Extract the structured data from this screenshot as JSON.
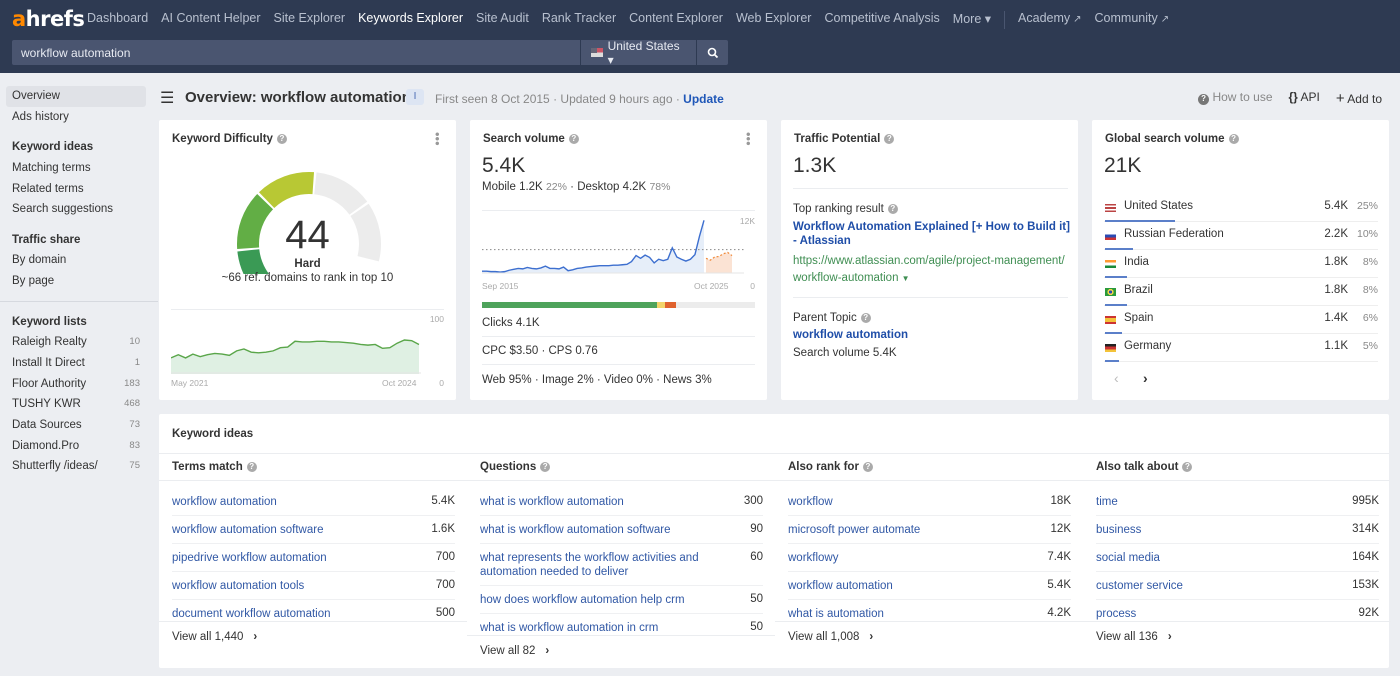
{
  "topnav": {
    "logo_accent": "a",
    "logo_rest": "hrefs",
    "items": [
      {
        "label": "Dashboard",
        "active": false
      },
      {
        "label": "AI Content Helper",
        "active": false
      },
      {
        "label": "Site Explorer",
        "active": false
      },
      {
        "label": "Keywords Explorer",
        "active": true
      },
      {
        "label": "Site Audit",
        "active": false
      },
      {
        "label": "Rank Tracker",
        "active": false
      },
      {
        "label": "Content Explorer",
        "active": false
      },
      {
        "label": "Web Explorer",
        "active": false
      },
      {
        "label": "Competitive Analysis",
        "active": false
      },
      {
        "label": "More ▾",
        "active": false
      }
    ],
    "external": [
      {
        "label": "Academy"
      },
      {
        "label": "Community"
      }
    ],
    "search_value": "workflow automation",
    "country": "United States ▾"
  },
  "sidebar": {
    "overview": "Overview",
    "ads_history": "Ads history",
    "keyword_ideas_head": "Keyword ideas",
    "keyword_ideas": [
      "Matching terms",
      "Related terms",
      "Search suggestions"
    ],
    "traffic_share_head": "Traffic share",
    "traffic_share": [
      "By domain",
      "By page"
    ],
    "keyword_lists_head": "Keyword lists",
    "keyword_lists": [
      {
        "name": "Raleigh Realty",
        "count": "10"
      },
      {
        "name": "Install It Direct",
        "count": "1"
      },
      {
        "name": "Floor Authority",
        "count": "183"
      },
      {
        "name": "TUSHY KWR",
        "count": "468"
      },
      {
        "name": "Data Sources",
        "count": "73"
      },
      {
        "name": "Diamond.Pro",
        "count": "83"
      },
      {
        "name": "Shutterfly /ideas/",
        "count": "75"
      }
    ]
  },
  "header": {
    "title": "Overview: workflow automation",
    "badge": "I",
    "first_seen": "First seen 8 Oct 2015",
    "updated": "Updated 9 hours ago",
    "update_link": "Update",
    "how_to_use": "How to use",
    "api": "API",
    "add_to": "Add to"
  },
  "kd": {
    "title": "Keyword Difficulty",
    "value": "44",
    "label": "Hard",
    "sub": "~66 ref. domains to rank in top 10",
    "score_pct": 44,
    "chart": {
      "x_start": "May 2021",
      "x_end": "Oct 2024",
      "y_max": "100",
      "y_min": "0",
      "values": [
        22,
        27,
        22,
        28,
        24,
        27,
        29,
        28,
        26,
        33,
        36,
        31,
        30,
        31,
        33,
        38,
        39,
        48,
        47,
        47,
        48,
        48,
        47,
        47,
        46,
        45,
        43,
        42,
        43,
        37,
        38,
        45,
        50,
        49,
        43
      ]
    }
  },
  "sv": {
    "title": "Search volume",
    "value": "5.4K",
    "mobile": "Mobile 1.2K",
    "mobile_pct": "22%",
    "desktop": "Desktop 4.2K",
    "desktop_pct": "78%",
    "chart": {
      "x_start": "Sep 2015",
      "x_end": "Oct 2025",
      "y_max": "12K",
      "y_min": "0",
      "values": [
        0.4,
        0.4,
        0.3,
        0.3,
        0.2,
        0.3,
        0.6,
        0.8,
        1.0,
        0.9,
        1.2,
        1.0,
        0.9,
        1.1,
        1.5,
        1.0,
        1.0,
        0.9,
        1.3,
        0.5,
        0.7,
        1.0,
        1.1,
        1.3,
        1.4,
        1.5,
        1.6,
        1.6,
        1.6,
        1.7,
        1.7,
        1.8,
        1.9,
        2.5,
        3.8,
        3.2,
        3.9,
        3.4,
        2.2,
        3.0,
        2.7,
        3.0,
        5.5,
        3.5,
        3.0,
        2.6,
        3.0,
        4.0,
        8.0,
        11.5
      ],
      "forecast": [
        3.2,
        2.8,
        3.5,
        3.6,
        4.2,
        4.5,
        3.8
      ],
      "avg_line": 5.1
    },
    "clicks_bar": {
      "organic": 0.64,
      "yellow": 0.03,
      "orange": 0.04
    },
    "clicks": "Clicks 4.1K",
    "cpc": "CPC $3.50",
    "cps": "CPS 0.76",
    "serp": [
      "Web 95%",
      "Image 2%",
      "Video 0%",
      "News 3%"
    ]
  },
  "tp": {
    "title": "Traffic Potential",
    "value": "1.3K",
    "top_result_label": "Top ranking result",
    "top_result_title": "Workflow Automation Explained [+ How to Build it] - Atlassian",
    "top_result_url": "https://www.atlassian.com/agile/project-management/workflow-automation",
    "parent_topic_label": "Parent Topic",
    "parent_topic": "workflow automation",
    "parent_volume": "Search volume 5.4K"
  },
  "gsv": {
    "title": "Global search volume",
    "value": "21K",
    "countries": [
      {
        "name": "United States",
        "volume": "5.4K",
        "pct": "25%",
        "share": 25,
        "flag": "us"
      },
      {
        "name": "Russian Federation",
        "volume": "2.2K",
        "pct": "10%",
        "share": 10,
        "flag": "ru"
      },
      {
        "name": "India",
        "volume": "1.8K",
        "pct": "8%",
        "share": 8,
        "flag": "in"
      },
      {
        "name": "Brazil",
        "volume": "1.8K",
        "pct": "8%",
        "share": 8,
        "flag": "br"
      },
      {
        "name": "Spain",
        "volume": "1.4K",
        "pct": "6%",
        "share": 6,
        "flag": "es"
      },
      {
        "name": "Germany",
        "volume": "1.1K",
        "pct": "5%",
        "share": 5,
        "flag": "de"
      }
    ]
  },
  "ideas": {
    "title": "Keyword ideas",
    "columns": [
      {
        "head": "Terms match",
        "view_all": "View all 1,440",
        "rows": [
          {
            "kw": "workflow automation",
            "v": "5.4K"
          },
          {
            "kw": "workflow automation software",
            "v": "1.6K"
          },
          {
            "kw": "pipedrive workflow automation",
            "v": "700"
          },
          {
            "kw": "workflow automation tools",
            "v": "700"
          },
          {
            "kw": "document workflow automation",
            "v": "500"
          }
        ]
      },
      {
        "head": "Questions",
        "view_all": "View all 82",
        "rows": [
          {
            "kw": "what is workflow automation",
            "v": "300"
          },
          {
            "kw": "what is workflow automation software",
            "v": "90"
          },
          {
            "kw": "what represents the workflow activities and automation needed to deliver",
            "v": "60"
          },
          {
            "kw": "how does workflow automation help crm",
            "v": "50"
          },
          {
            "kw": "what is workflow automation in crm",
            "v": "50"
          }
        ]
      },
      {
        "head": "Also rank for",
        "view_all": "View all 1,008",
        "rows": [
          {
            "kw": "workflow",
            "v": "18K"
          },
          {
            "kw": "microsoft power automate",
            "v": "12K"
          },
          {
            "kw": "workflowy",
            "v": "7.4K"
          },
          {
            "kw": "workflow automation",
            "v": "5.4K"
          },
          {
            "kw": "what is automation",
            "v": "4.2K"
          }
        ]
      },
      {
        "head": "Also talk about",
        "view_all": "View all 136",
        "rows": [
          {
            "kw": "time",
            "v": "995K"
          },
          {
            "kw": "business",
            "v": "314K"
          },
          {
            "kw": "social media",
            "v": "164K"
          },
          {
            "kw": "customer service",
            "v": "153K"
          },
          {
            "kw": "process",
            "v": "92K"
          }
        ]
      }
    ]
  }
}
